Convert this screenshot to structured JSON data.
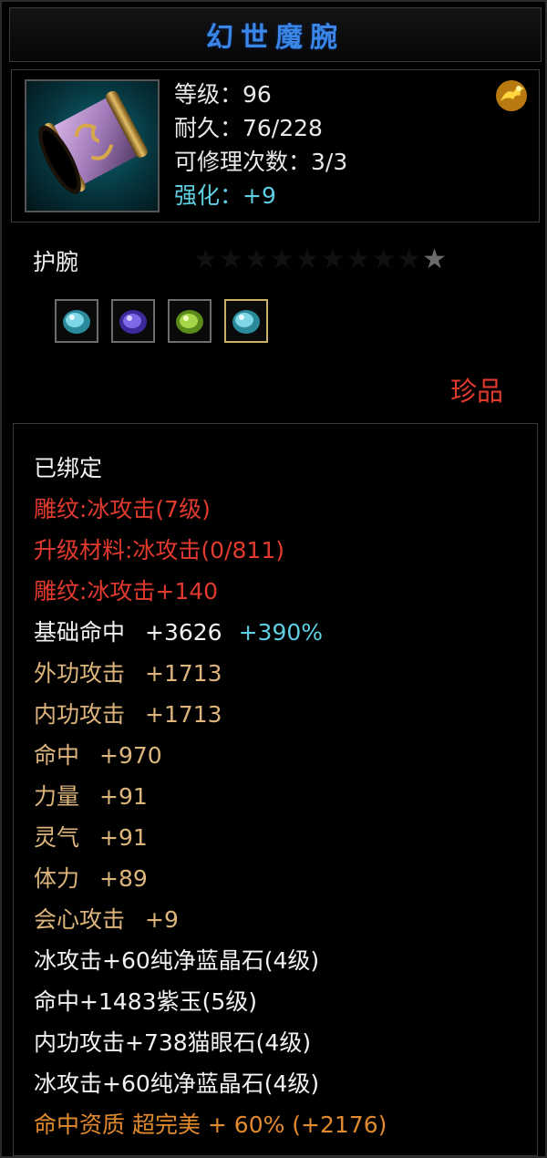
{
  "title": "幻世魔腕",
  "stats": [
    {
      "label": "等级：96",
      "kind": "normal"
    },
    {
      "label": "耐久：76/228",
      "kind": "normal"
    },
    {
      "label": "可修理次数：3/3",
      "kind": "normal"
    },
    {
      "label": "强化：+9",
      "kind": "strengthen"
    }
  ],
  "item_type": "护腕",
  "stars": {
    "lit": 1,
    "total": 10
  },
  "gems": [
    {
      "icon": "cyan-gem-icon",
      "color": "#7fd6e6"
    },
    {
      "icon": "purple-gem-icon",
      "color": "#7e6ae8"
    },
    {
      "icon": "green-gem-icon",
      "color": "#a8d64a"
    },
    {
      "icon": "cyan-gem-icon",
      "color": "#7fd6e6"
    }
  ],
  "quality": "珍品",
  "attributes": [
    {
      "text": "已绑定",
      "color": "white"
    },
    {
      "text": "雕纹:冰攻击(7级)",
      "color": "red"
    },
    {
      "text": "升级材料:冰攻击(0/811)",
      "color": "red"
    },
    {
      "text": "雕纹:冰攻击+140",
      "color": "red"
    },
    {
      "name": "基础命中",
      "value": "+3626",
      "bonus": "+390%",
      "color": "white"
    },
    {
      "name": "外功攻击",
      "value": "+1713",
      "color": "gold"
    },
    {
      "name": "内功攻击",
      "value": "+1713",
      "color": "gold"
    },
    {
      "name": "命中",
      "value": "+970",
      "color": "gold"
    },
    {
      "name": "力量",
      "value": "+91",
      "color": "gold"
    },
    {
      "name": "灵气",
      "value": "+91",
      "color": "gold"
    },
    {
      "name": "体力",
      "value": "+89",
      "color": "gold"
    },
    {
      "name": "会心攻击",
      "value": "+9",
      "color": "gold"
    },
    {
      "text": "冰攻击+60纯净蓝晶石(4级)",
      "color": "white"
    },
    {
      "text": "命中+1483紫玉(5级)",
      "color": "white"
    },
    {
      "text": "内功攻击+738猫眼石(4级)",
      "color": "white"
    },
    {
      "text": "冰攻击+60纯净蓝晶石(4级)",
      "color": "white"
    },
    {
      "text": "命中资质  超完美  + 60% (+2176)",
      "color": "orange"
    }
  ],
  "colors": {
    "title": "#3a86e6",
    "strengthen": "#5ecfe3",
    "red": "#e23a2e",
    "gold": "#ddb57c",
    "orange": "#e28a2e"
  }
}
